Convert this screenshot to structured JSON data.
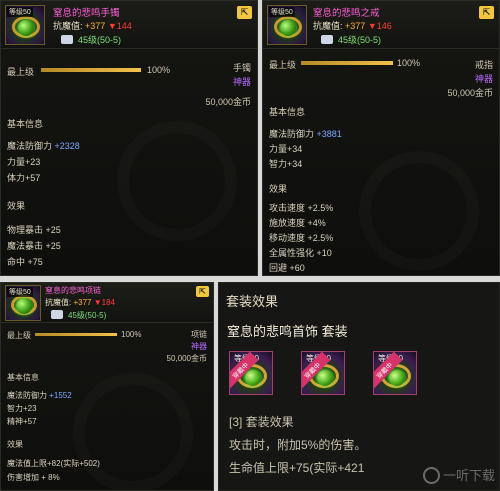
{
  "panel_bracelet": {
    "level": "等级50",
    "name": "窒息的悲鸣手镯",
    "resist_label": "抗魔值:",
    "resist_up": "+377",
    "resist_down": "▼144",
    "grade": "45级(50-5)",
    "top_label": "最上级",
    "top_percent": "100%",
    "top_progress": 1.0,
    "slot_type": "手镯",
    "rarity": "神器",
    "price": "50,000金币",
    "basic_title": "基本信息",
    "basic": [
      {
        "label": "魔法防御力",
        "value": "+2328"
      },
      {
        "label": "力量",
        "value": "+23"
      },
      {
        "label": "体力",
        "value": "+57"
      }
    ],
    "effect_title": "效果",
    "effects": [
      "物理暴击 +25",
      "魔法暴击 +25",
      "命中 +75"
    ]
  },
  "panel_ring": {
    "level": "等级50",
    "name": "窒息的悲鸣之戒",
    "resist_label": "抗魔值:",
    "resist_up": "+377",
    "resist_down": "▼146",
    "grade": "45级(50-5)",
    "top_label": "最上级",
    "top_percent": "100%",
    "top_progress": 1.0,
    "slot_type": "戒指",
    "rarity": "神器",
    "price": "50,000金币",
    "basic_title": "基本信息",
    "basic": [
      {
        "label": "魔法防御力",
        "value": "+3881"
      },
      {
        "label": "力量",
        "value": "+34"
      },
      {
        "label": "智力",
        "value": "+34"
      }
    ],
    "effect_title": "效果",
    "effects": [
      "攻击速度 +2.5%",
      "施放速度 +4%",
      "移动速度 +2.5%",
      "全属性强化 +10",
      "回避 +60"
    ]
  },
  "panel_necklace": {
    "level": "等级50",
    "name": "窒息的悲鸣项链",
    "resist_label": "抗魔值:",
    "resist_up": "+377",
    "resist_down": "▼184",
    "grade": "45级(50-5)",
    "top_label": "最上级",
    "top_percent": "100%",
    "top_progress": 1.0,
    "slot_type": "项链",
    "rarity": "神器",
    "price": "50,000金币",
    "basic_title": "基本信息",
    "basic": [
      {
        "label": "魔法防御力",
        "value": "+1552"
      },
      {
        "label": "智力",
        "value": "+23"
      },
      {
        "label": "精神",
        "value": "+57"
      }
    ],
    "effect_title": "效果",
    "effects": [
      "魔法值上限+82(实际+502)",
      "伤害增加 + 8%"
    ]
  },
  "set_panel": {
    "title": "套装效果",
    "set_name": "窒息的悲鸣首饰 套装",
    "slots": [
      {
        "level": "等级50",
        "ribbon": "穿戴中"
      },
      {
        "level": "等级50",
        "ribbon": "穿戴中"
      },
      {
        "level": "等级50",
        "ribbon": "穿戴中"
      }
    ],
    "effect_header": "[3] 套装效果",
    "effect_lines": [
      "攻击时，附加5%的伤害。",
      "生命值上限+75(实际+421"
    ],
    "watermark": "一听下载"
  },
  "colors": {
    "name_pink": "#ff5fd8",
    "rarity_purple": "#b56bff",
    "grade_green": "#7fe07a",
    "defense_blue": "#7fa8ff",
    "progress_gold": "#f1c24c"
  }
}
